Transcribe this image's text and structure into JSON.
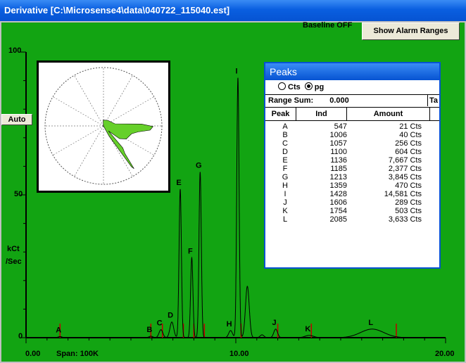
{
  "window": {
    "title": "Derivative [C:\\Microsense4\\data\\040722_115040.est]"
  },
  "status": {
    "baseline": "Baseline OFF"
  },
  "buttons": {
    "alarm_label": "Show Alarm Ranges",
    "auto_label": "Auto"
  },
  "yaxis": {
    "label_line1": "kCt",
    "label_line2": "/Sec",
    "ticks": [
      "100",
      "50",
      "0"
    ]
  },
  "xaxis": {
    "start": "0.00",
    "mid": "10.00",
    "end": "20.00",
    "span": "Span: 100K"
  },
  "colors": {
    "plot_bg": "#12a412",
    "trace": "#000000",
    "alarm_marker": "#c00000",
    "rose_fill": "#66d02a",
    "title_bar": "#0653d2"
  },
  "chart_data": {
    "type": "line",
    "xlim": [
      0,
      20
    ],
    "ylim": [
      0,
      100
    ],
    "x_ticks": [
      "0.00",
      "10.00",
      "20.00"
    ],
    "y_ticks": [
      "100",
      "50",
      "0"
    ],
    "ylabel": "kCt /Sec",
    "peaks": [
      {
        "label": "A",
        "x": 1.62,
        "y": 0.4
      },
      {
        "label": "B",
        "x": 5.95,
        "y": 0.5
      },
      {
        "label": "C",
        "x": 6.43,
        "y": 2.8
      },
      {
        "label": "D",
        "x": 6.95,
        "y": 5.5
      },
      {
        "label": "E",
        "x": 7.35,
        "y": 52
      },
      {
        "label": "F",
        "x": 7.9,
        "y": 28
      },
      {
        "label": "G",
        "x": 8.3,
        "y": 58
      },
      {
        "label": "H",
        "x": 9.75,
        "y": 2.5
      },
      {
        "label": "I",
        "x": 10.1,
        "y": 91
      },
      {
        "label": "J",
        "x": 11.9,
        "y": 3
      },
      {
        "label": "K",
        "x": 13.5,
        "y": 0.8
      },
      {
        "label": "L",
        "x": 16.5,
        "y": 3
      }
    ],
    "extra_peaks": [
      {
        "x": 10.55,
        "y": 18
      },
      {
        "x": 11.25,
        "y": 1
      }
    ],
    "alarm_markers_x": [
      1.62,
      5.95,
      6.5,
      7.5,
      8.0,
      8.5,
      10.25,
      12.0,
      13.6,
      17.65
    ]
  },
  "rose": {
    "spokes": 12,
    "values": [
      0.58,
      0.35,
      0.55,
      0.48,
      0.3,
      0.45,
      0.2,
      0.1,
      0.05,
      0.05,
      0.1,
      0.15
    ]
  },
  "peaks_panel": {
    "title": "Peaks",
    "radio_cts": "Cts",
    "radio_pg": "pg",
    "selected": "pg",
    "range_sum_label": "Range Sum:",
    "range_sum_value": "0.000",
    "extra_col": "Ta",
    "columns": [
      "Peak",
      "Ind",
      "Amount"
    ],
    "rows": [
      {
        "peak": "A",
        "ind": "547",
        "amount": "21 Cts"
      },
      {
        "peak": "B",
        "ind": "1006",
        "amount": "40 Cts"
      },
      {
        "peak": "C",
        "ind": "1057",
        "amount": "256 Cts"
      },
      {
        "peak": "D",
        "ind": "1100",
        "amount": "604 Cts"
      },
      {
        "peak": "E",
        "ind": "1136",
        "amount": "7,667 Cts"
      },
      {
        "peak": "F",
        "ind": "1185",
        "amount": "2,377 Cts"
      },
      {
        "peak": "G",
        "ind": "1213",
        "amount": "3,845 Cts"
      },
      {
        "peak": "H",
        "ind": "1359",
        "amount": "470 Cts"
      },
      {
        "peak": "I",
        "ind": "1428",
        "amount": "14,581 Cts"
      },
      {
        "peak": "J",
        "ind": "1606",
        "amount": "289 Cts"
      },
      {
        "peak": "K",
        "ind": "1754",
        "amount": "503 Cts"
      },
      {
        "peak": "L",
        "ind": "2085",
        "amount": "3,633 Cts"
      }
    ]
  }
}
